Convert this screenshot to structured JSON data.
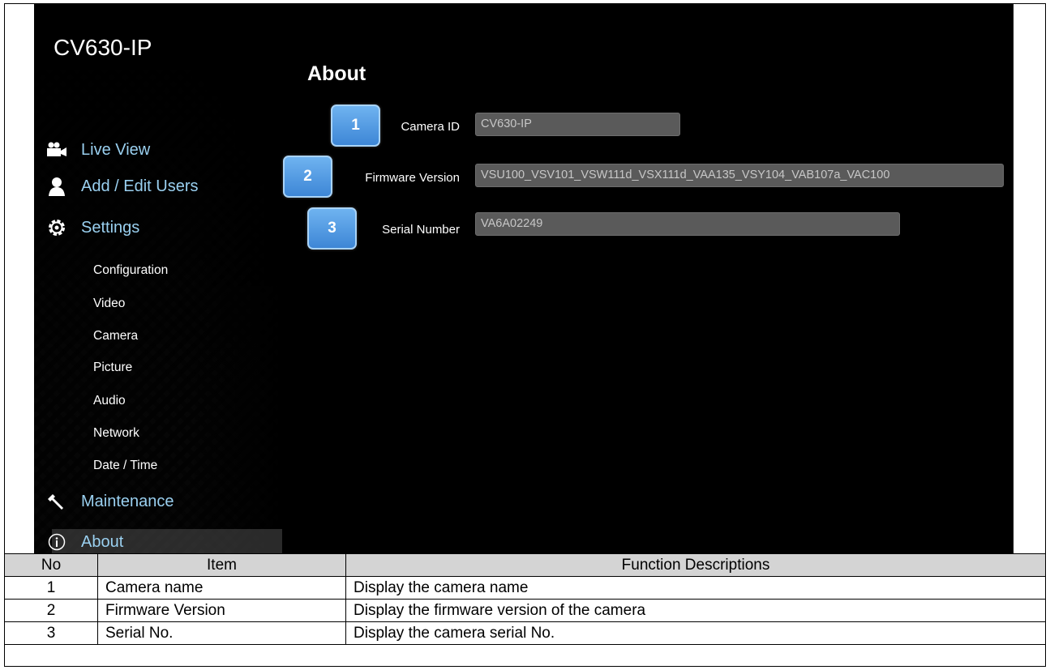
{
  "brand": "CV630-IP",
  "nav": {
    "live_view": "Live View",
    "add_edit_users": "Add / Edit Users",
    "settings": "Settings",
    "sub": [
      "Configuration",
      "Video",
      "Camera",
      "Picture",
      "Audio",
      "Network",
      "Date / Time"
    ],
    "maintenance": "Maintenance",
    "about": "About"
  },
  "page": {
    "title": "About",
    "fields": [
      {
        "badge": "1",
        "label": "Camera ID",
        "value": "CV630-IP"
      },
      {
        "badge": "2",
        "label": "Firmware Version",
        "value": "VSU100_VSV101_VSW111d_VSX111d_VAA135_VSY104_VAB107a_VAC100"
      },
      {
        "badge": "3",
        "label": "Serial Number",
        "value": "VA6A02249"
      }
    ]
  },
  "icons": {
    "live_view": "video-camera-icon",
    "users": "user-icon",
    "settings": "gear-icon",
    "maintenance": "wrench-icon",
    "about": "info-icon"
  },
  "colors": {
    "nav_accent": "#9ad0f0",
    "badge": "#4a93de",
    "table_header": "#d4d4d4"
  },
  "table": {
    "headers": [
      "No",
      "Item",
      "Function Descriptions"
    ],
    "rows": [
      [
        "1",
        "Camera name",
        "Display the camera name"
      ],
      [
        "2",
        "Firmware Version",
        "Display the firmware version of the camera"
      ],
      [
        "3",
        "Serial No.",
        "Display the camera serial No."
      ]
    ]
  }
}
